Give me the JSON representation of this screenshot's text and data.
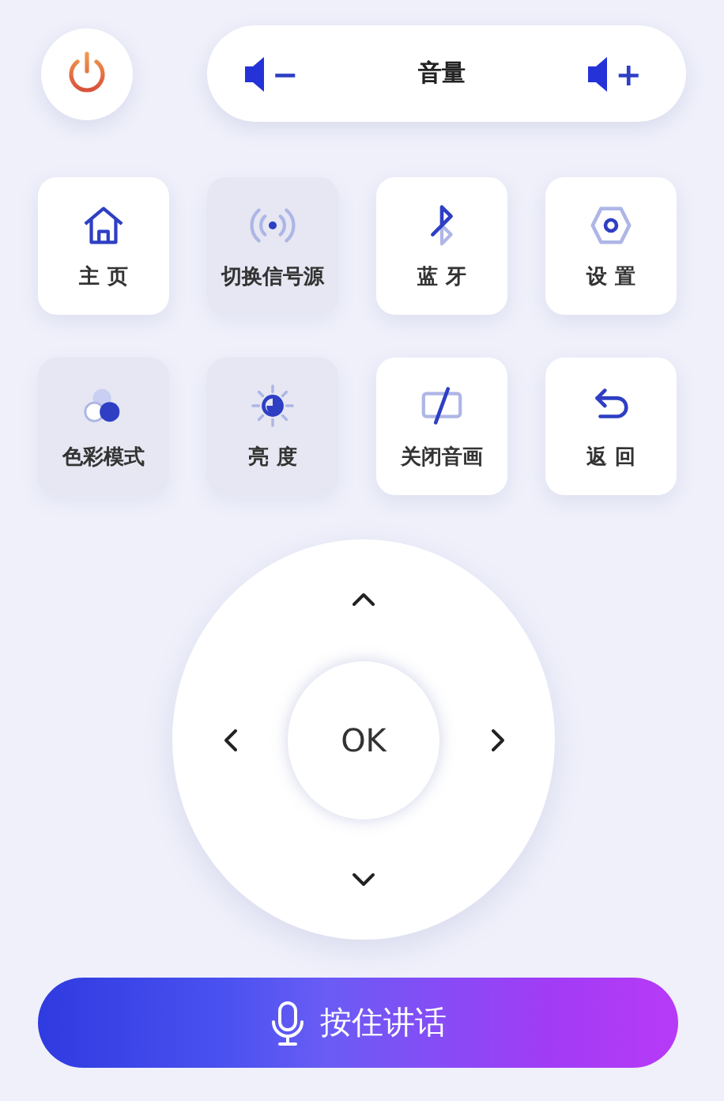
{
  "volume": {
    "label": "音量",
    "down": "−",
    "up": "+"
  },
  "tiles": [
    {
      "kind": "home",
      "label": "主 页",
      "selected": false
    },
    {
      "kind": "signal",
      "label": "切换信号源",
      "selected": true
    },
    {
      "kind": "bluetooth",
      "label": "蓝 牙",
      "selected": false
    },
    {
      "kind": "settings",
      "label": "设 置",
      "selected": false
    },
    {
      "kind": "color",
      "label": "色彩模式",
      "selected": true
    },
    {
      "kind": "brightness",
      "label": "亮 度",
      "selected": true
    },
    {
      "kind": "screen-off",
      "label": "关闭音画",
      "selected": false
    },
    {
      "kind": "back",
      "label": "返 回",
      "selected": false
    }
  ],
  "dpad": {
    "ok": "OK"
  },
  "talk": {
    "label": "按住讲话"
  }
}
